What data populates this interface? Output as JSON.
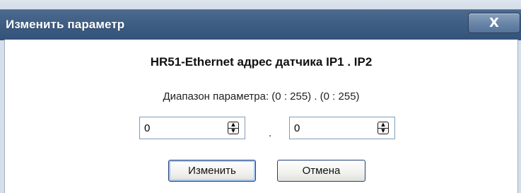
{
  "dialog": {
    "title": "Изменить параметр",
    "close_label": "X",
    "heading": "HR51-Ethernet адрес датчика IP1 . IP2",
    "range_text": "Диапазон параметра: (0 : 255) . (0 : 255)",
    "field1_value": "0",
    "separator": ".",
    "field2_value": "0",
    "ok_label": "Изменить",
    "cancel_label": "Отмена",
    "spin_up": "▲",
    "spin_down": "▼"
  }
}
